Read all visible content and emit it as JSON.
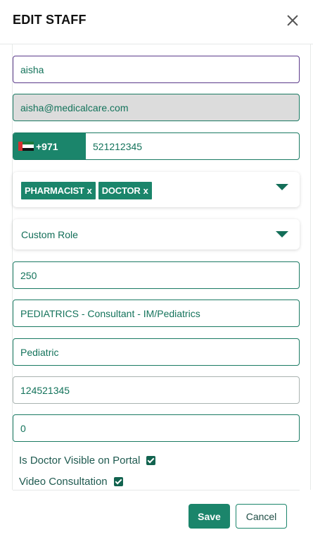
{
  "header": {
    "title": "EDIT STAFF"
  },
  "form": {
    "name": "aisha",
    "email": "aisha@medicalcare.com",
    "phone": {
      "country_code": "+971",
      "number": "521212345"
    },
    "roles": [
      "PHARMACIST",
      "DOCTOR"
    ],
    "chip_remove": "x",
    "custom_role": "Custom Role",
    "fee": "250",
    "department": "PEDIATRICS - Consultant - IM/Pediatrics",
    "specialty": "Pediatric",
    "license": "124521345",
    "experience": "0",
    "visible_on_portal": {
      "label": "Is Doctor Visible on Portal",
      "checked": true
    },
    "video_consultation": {
      "label": "Video Consultation",
      "checked": true
    }
  },
  "footer": {
    "save": "Save",
    "cancel": "Cancel"
  },
  "colors": {
    "accent": "#1b856b",
    "focus_border": "#5b3a8a",
    "disabled_bg": "#dcdcdc"
  }
}
